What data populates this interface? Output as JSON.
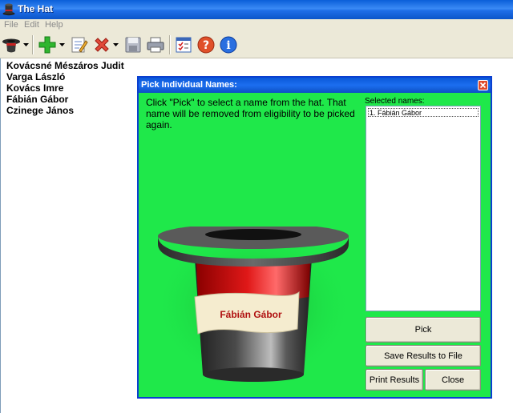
{
  "window": {
    "title": "The Hat"
  },
  "menu": {
    "items": [
      "File",
      "Edit",
      "Help"
    ]
  },
  "toolbar": {
    "icons": [
      "hat-icon",
      "add-icon",
      "edit-icon",
      "delete-icon",
      "save-icon",
      "print-icon",
      "list-icon",
      "help-icon",
      "info-icon"
    ]
  },
  "names": [
    "Kovácsné Mészáros Judit",
    "Varga László",
    "Kovács Imre",
    "Fábián Gábor",
    "Czinege János"
  ],
  "dialog": {
    "title": "Pick Individual Names:",
    "instructions": "Click \"Pick\" to select a name from the hat. That name will be removed from eligibility to be picked again.",
    "selected_label": "Selected names:",
    "selected_items": [
      "1. Fábián Gábor"
    ],
    "hat_name": "Fábián Gábor",
    "buttons": {
      "pick": "Pick",
      "save": "Save Results to File",
      "print": "Print Results",
      "close": "Close"
    }
  },
  "colors": {
    "dialog_bg": "#1fe84a",
    "title_blue": "#0a58d8",
    "hat_band": "#e01818",
    "hat_name_text": "#b01010"
  }
}
